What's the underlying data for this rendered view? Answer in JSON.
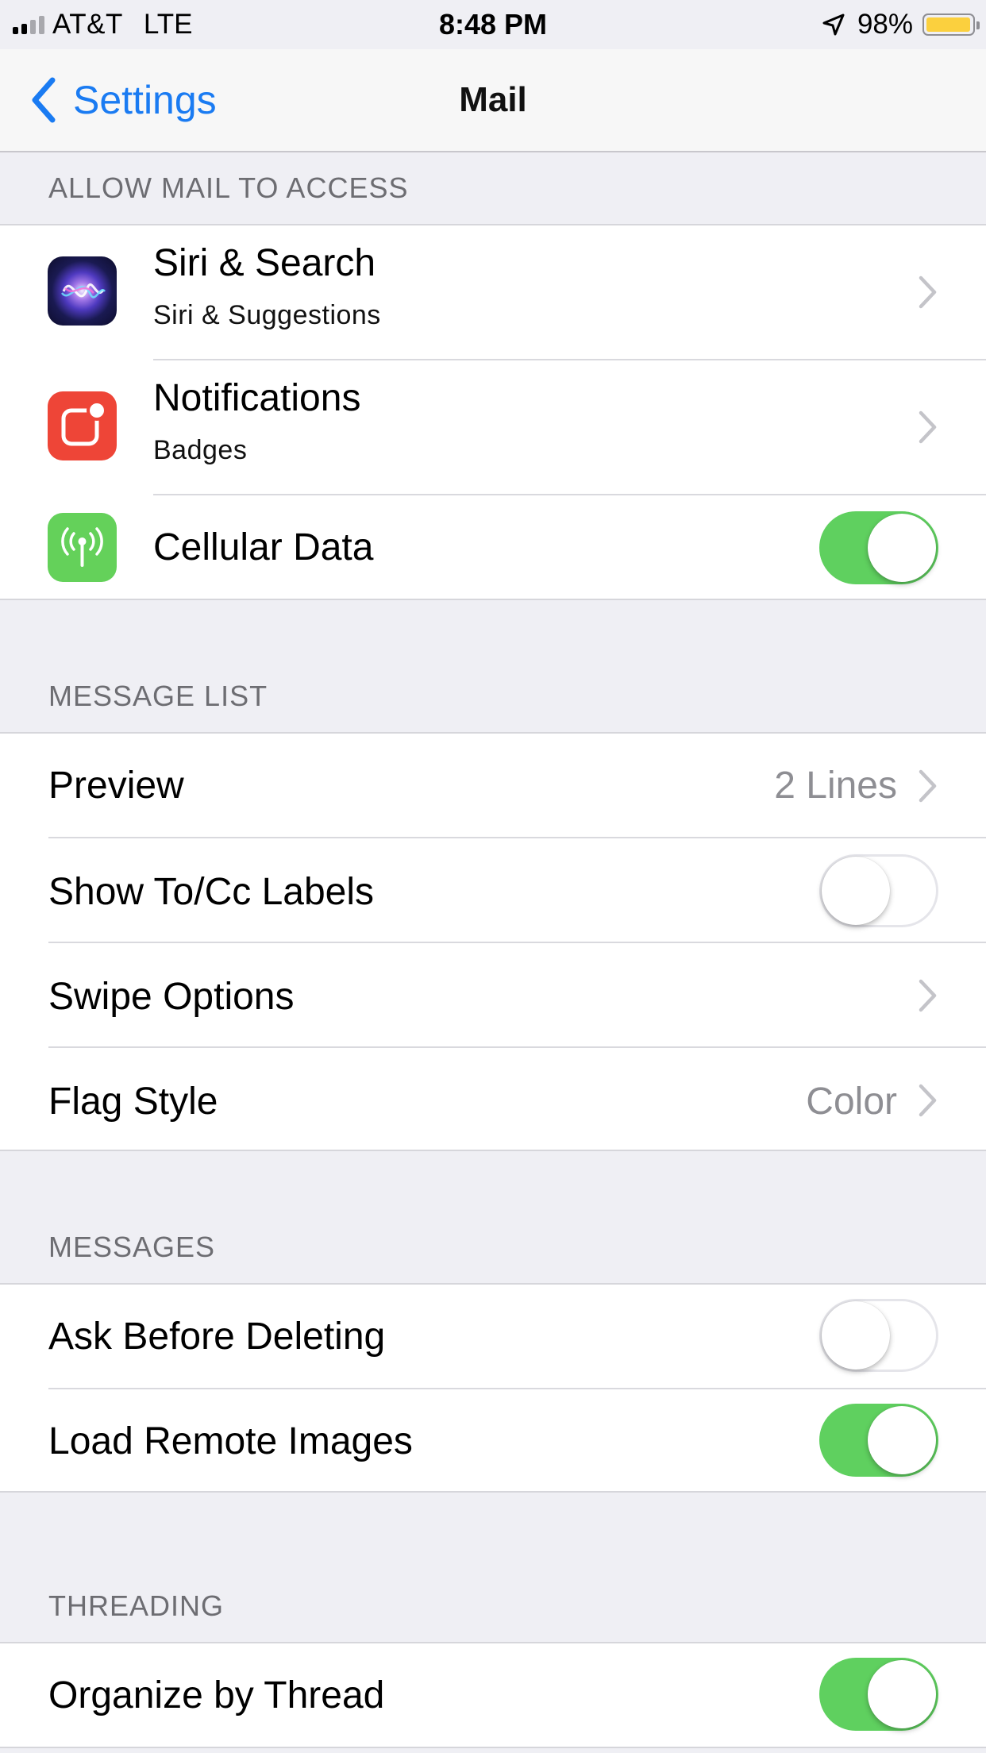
{
  "status_bar": {
    "carrier": "AT&T",
    "network": "LTE",
    "time": "8:48 PM",
    "battery_percent": "98%",
    "battery_level": 0.98,
    "signal_bars_active": 2,
    "signal_bars_total": 4,
    "icons": [
      "signal-icon",
      "location-arrow-icon",
      "battery-icon"
    ]
  },
  "nav": {
    "back_label": "Settings",
    "title": "Mail"
  },
  "sections": {
    "allow_access": {
      "header": "ALLOW MAIL TO ACCESS",
      "rows": [
        {
          "label": "Siri & Search",
          "subtitle": "Siri & Suggestions",
          "icon": "siri-icon"
        },
        {
          "label": "Notifications",
          "subtitle": "Badges",
          "icon": "notifications-icon"
        },
        {
          "label": "Cellular Data",
          "icon": "cellular-antenna-icon",
          "toggle": true
        }
      ]
    },
    "message_list": {
      "header": "MESSAGE LIST",
      "rows": [
        {
          "label": "Preview",
          "value": "2 Lines"
        },
        {
          "label": "Show To/Cc Labels",
          "toggle": false
        },
        {
          "label": "Swipe Options"
        },
        {
          "label": "Flag Style",
          "value": "Color"
        }
      ]
    },
    "messages": {
      "header": "MESSAGES",
      "rows": [
        {
          "label": "Ask Before Deleting",
          "toggle": false
        },
        {
          "label": "Load Remote Images",
          "toggle": true
        }
      ]
    },
    "threading": {
      "header": "THREADING",
      "rows": [
        {
          "label": "Organize by Thread",
          "toggle": true
        }
      ]
    }
  },
  "colors": {
    "accent": "#1a7bf2",
    "toggle_on": "#5fd05f",
    "background": "#efeff4",
    "secondary_text": "#8e8e93",
    "battery": "#fbd03e"
  }
}
